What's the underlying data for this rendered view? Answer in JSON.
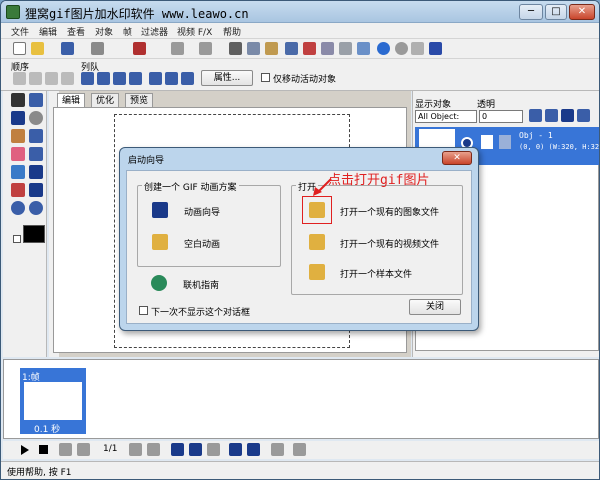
{
  "app": {
    "title": "狸窝gif图片加水印软件   www.leawo.cn",
    "controls": {
      "minimize": "─",
      "maximize": "□",
      "close": "✕"
    }
  },
  "menu": [
    "文件",
    "编辑",
    "查看",
    "对象",
    "帧",
    "过滤器",
    "视频 F/X",
    "帮助"
  ],
  "toolbar2": {
    "order_label": "顺序",
    "queue_label": "列队",
    "properties_button": "属性...",
    "move_active_only": "仅移动活动对象"
  },
  "tabs": [
    "编辑",
    "优化",
    "预览"
  ],
  "right_panel": {
    "display_objects_label": "显示对象",
    "transparency_label": "透明",
    "select_value": "All Object:",
    "transparency_value": "0",
    "object": {
      "name": "Obj - 1",
      "coords": "(0, 0) (W:320, H:320"
    }
  },
  "frames": {
    "frame_label": "1:帧",
    "frame_delay": "0.1 秒",
    "counter": "1/1"
  },
  "status": "使用帮助, 按 F1",
  "dialog": {
    "title": "启动向导",
    "create_group_title": "创建一个 GIF 动画方案",
    "create_items": [
      "动画向导",
      "空白动画"
    ],
    "online_guide": "联机指南",
    "open_group_title": "打开",
    "open_items": [
      "打开一个现有的图象文件",
      "打开一个现有的视频文件",
      "打开一个样本文件"
    ],
    "dont_show": "下一次不显示这个对话框",
    "close_button": "关闭",
    "close_x": "✕"
  },
  "annotation": "点击打开gif图片",
  "colors": {
    "accent": "#3875d7",
    "annotation": "#e02020"
  }
}
